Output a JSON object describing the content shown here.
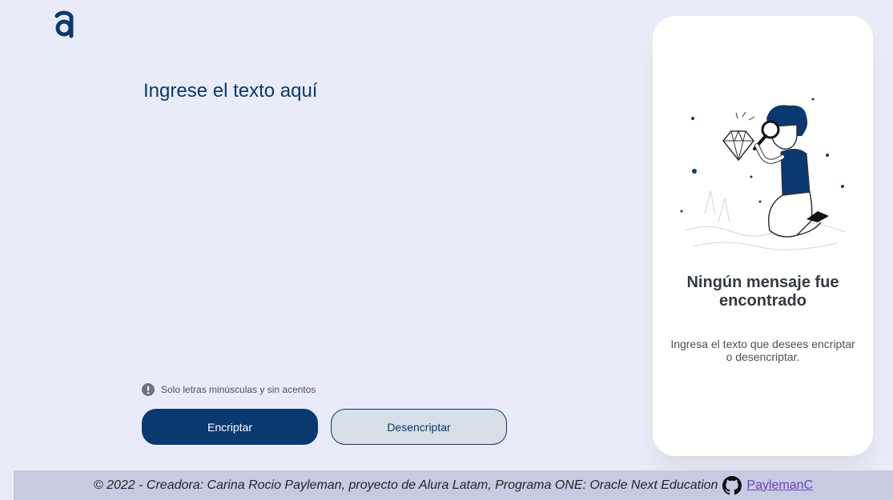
{
  "brand": {
    "logo_icon": "alura-logo-icon",
    "logo_color": "#0a3871"
  },
  "input": {
    "placeholder": "Ingrese el texto aquí",
    "value": ""
  },
  "hint": {
    "icon": "exclamation-circle-icon",
    "text": "Solo letras minúsculas y sin acentos"
  },
  "buttons": {
    "encrypt_label": "Encriptar",
    "decrypt_label": "Desencriptar"
  },
  "output": {
    "illustration": "person-with-magnifier-illustration",
    "title": "Ningún mensaje fue encontrado",
    "description": "Ingresa el texto que desees encriptar o desencriptar."
  },
  "footer": {
    "text": "© 2022 - Creadora: Carina Rocio Payleman, proyecto de Alura Latam, Programa ONE: Oracle Next Education",
    "icon": "github-icon",
    "link_label": "PaylemanC"
  },
  "colors": {
    "background": "#e9ecf8",
    "primary": "#0a3871",
    "secondary_button": "#d8dfe8",
    "card": "#ffffff",
    "footer_bg": "#c7cbe1",
    "link": "#6f42c1"
  }
}
